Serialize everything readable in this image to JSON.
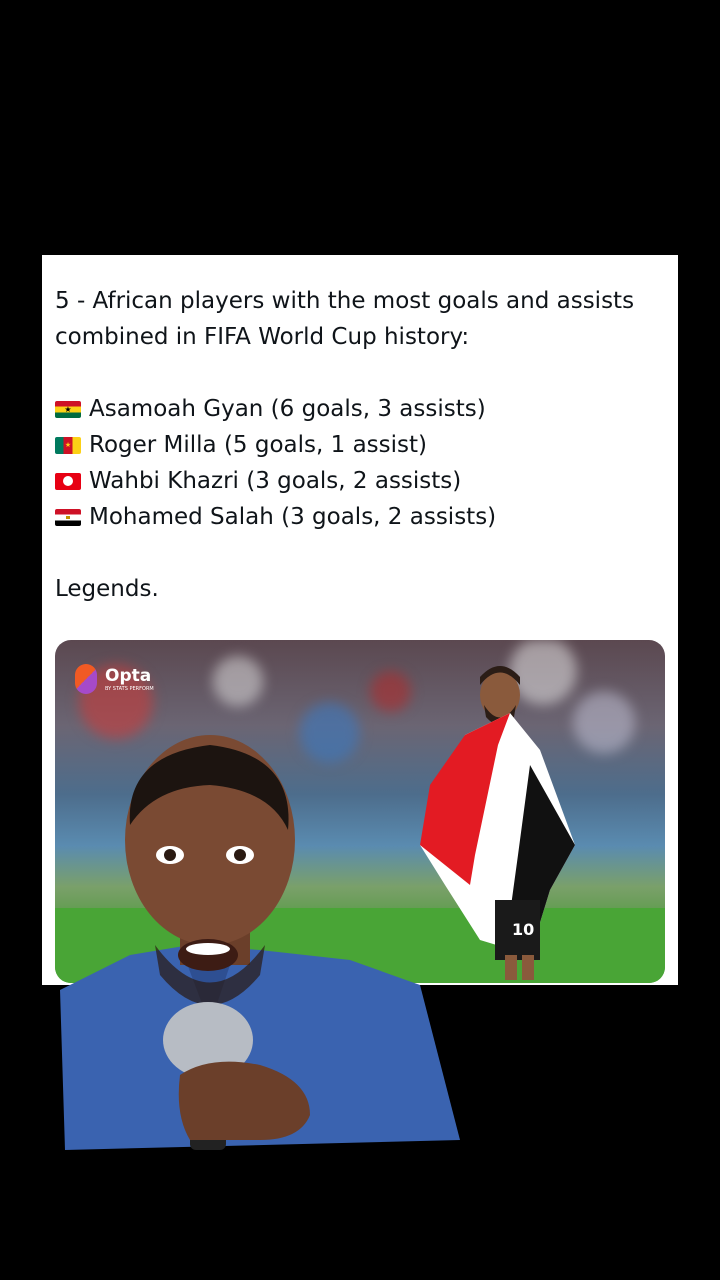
{
  "tweet": {
    "intro_line_1": "5 - African players with the most goals and assists",
    "intro_line_2": "combined in FIFA World Cup history:",
    "players": [
      {
        "flag": "ghana-flag",
        "text": "Asamoah Gyan (6 goals, 3 assists)"
      },
      {
        "flag": "cameroon-flag",
        "text": "Roger Milla (5 goals, 1 assist)"
      },
      {
        "flag": "tunisia-flag",
        "text": "Wahbi Khazri (3 goals, 2 assists)"
      },
      {
        "flag": "egypt-flag",
        "text": "Mohamed Salah (3 goals, 2 assists)"
      }
    ],
    "closing": "Legends."
  },
  "media": {
    "watermark": "Opta",
    "watermark_sub": "BY STATS PERFORM",
    "shirt_number": "10"
  },
  "colors": {
    "background": "#000000",
    "card": "#ffffff",
    "text": "#0f1419",
    "pitch": "#49a536"
  }
}
